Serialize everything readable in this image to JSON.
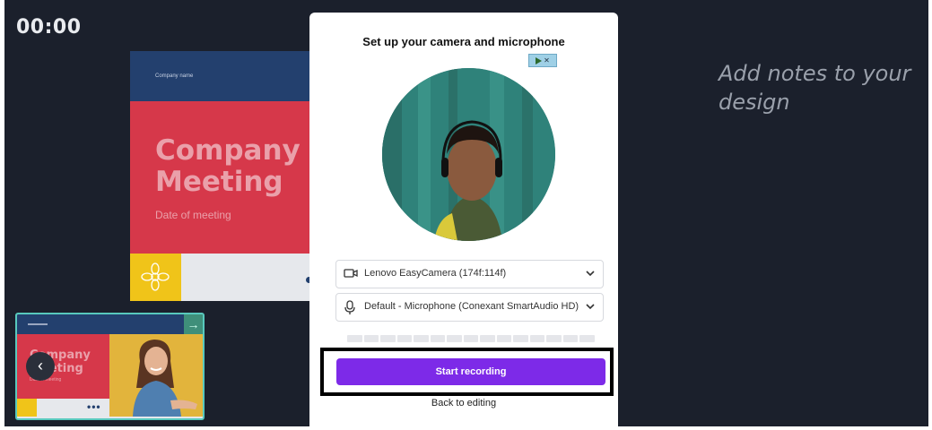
{
  "timer": "00:00",
  "notes_placeholder": "Add notes to your design",
  "slide": {
    "company_name": "Company name",
    "title_line1": "Company",
    "title_line2": "Meeting",
    "date": "Date of meeting"
  },
  "thumbnail": {
    "title_line1": "Company",
    "title_line2": "Meeting",
    "subtitle": "Date of meeting",
    "more_label": "•••",
    "arrow_label": "→",
    "back_label": "‹"
  },
  "modal": {
    "title": "Set up your camera and microphone",
    "camera_select": "Lenovo EasyCamera (174f:114f)",
    "microphone_select": "Default - Microphone (Conexant SmartAudio HD)",
    "start_button": "Start recording",
    "back_link": "Back to editing",
    "mic_level": 0
  },
  "colors": {
    "background": "#1b202c",
    "accent_purple": "#7d2ae8",
    "slide_red": "#d6384a",
    "slide_navy": "#23406e",
    "slide_yellow": "#f0c419",
    "thumbnail_border": "#58c9bd"
  },
  "icons": [
    "camera-icon",
    "microphone-icon",
    "chevron-down-icon",
    "chevron-left-icon",
    "arrow-right-icon",
    "play-icon",
    "close-icon"
  ]
}
